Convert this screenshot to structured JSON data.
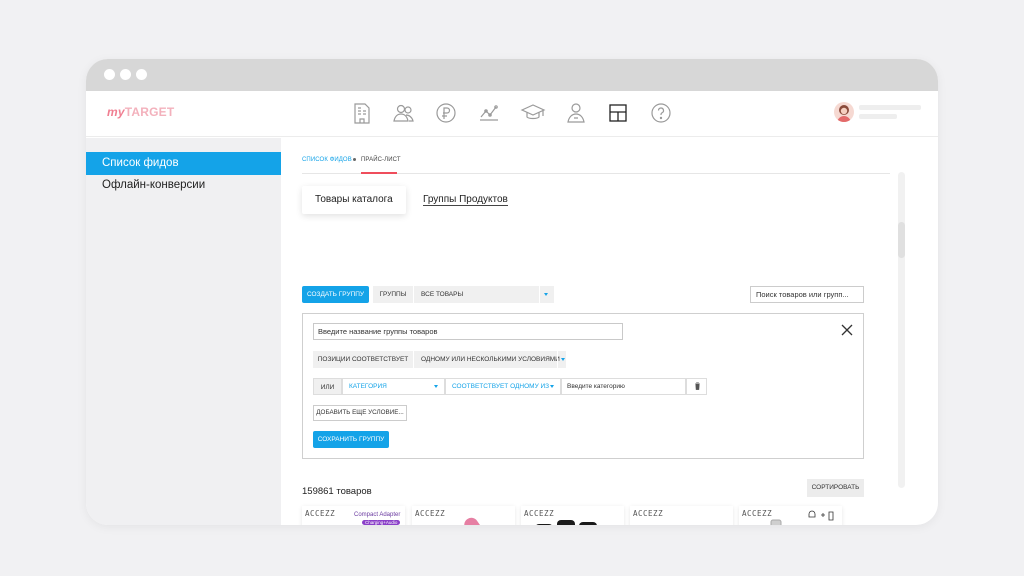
{
  "header": {
    "logo_my": "my",
    "logo_target": "TARGET",
    "nav_icons": [
      "building-icon",
      "people-icon",
      "ruble-icon",
      "chart-line-icon",
      "graduation-cap-icon",
      "person-icon",
      "layout-icon",
      "help-icon"
    ]
  },
  "sidebar": {
    "items": [
      {
        "label": "Список фидов",
        "active": true
      },
      {
        "label": "Офлайн-конверсии",
        "active": false
      }
    ]
  },
  "breadcrumb": {
    "link": "СПИСОК ФИДОВ",
    "current": "ПРАЙС-ЛИСТ"
  },
  "tabs": [
    {
      "label": "Товары каталога",
      "active": true
    },
    {
      "label": "Группы Продуктов",
      "active": false
    }
  ],
  "toolbar": {
    "create_group": "СОЗДАТЬ ГРУППУ",
    "groups_label": "ГРУППЫ",
    "groups_select": "ВСЕ ТОВАРЫ",
    "search_placeholder": "Поиск товаров или групп..."
  },
  "panel": {
    "name_placeholder": "Введите название группы товаров",
    "positions_label": "ПОЗИЦИИ СООТВЕТСТВУЕТ",
    "positions_select": "ОДНОМУ ИЛИ НЕСКОЛЬКИМИ УСЛОВИЯМИ",
    "condition": {
      "or_label": "ИЛИ",
      "field": "КАТЕГОРИЯ",
      "operator": "СООТВЕТСТВУЕТ ОДНОМУ ИЗ",
      "value_placeholder": "Введите категорию"
    },
    "add_condition": "ДОБАВИТЬ ЕЩЕ УСЛОВИЕ...",
    "save_group": "СОХРАНИТЬ ГРУППУ"
  },
  "products": {
    "count_text": "159861 товаров",
    "sort_label": "СОРТИРОВАТЬ",
    "cards": [
      {
        "brand": "ACCEZZ",
        "caption": "Compact Adapter",
        "badge": "Charging+Audio"
      },
      {
        "brand": "ACCEZZ"
      },
      {
        "brand": "ACCEZZ"
      },
      {
        "brand": "ACCEZZ"
      },
      {
        "brand": "ACCEZZ"
      }
    ]
  },
  "colors": {
    "accent": "#14a3e8",
    "breadcrumb_underline": "#ef4d5c",
    "logo": "#f07e91"
  }
}
